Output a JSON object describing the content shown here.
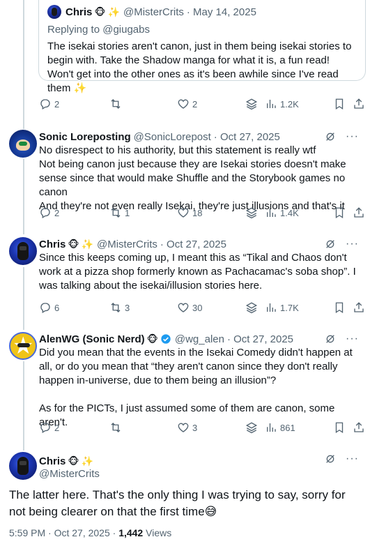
{
  "quoted": {
    "name": "Chris",
    "badges": [
      "🐵",
      "✨"
    ],
    "handle": "@MisterCrits",
    "date": "· May 14, 2025",
    "replying_to": "Replying to @giugabs",
    "text": "The isekai stories aren't canon, just in them being isekai stories to begin with. Take the Shadow manga for what it is, a fun read! Won't get into the other ones as it's been awhile since I've read them ✨"
  },
  "quoted_actions": {
    "replies": "2",
    "reposts": "",
    "likes": "2",
    "views": "1.2K"
  },
  "tweets": [
    {
      "name": "Sonic Loreposting",
      "badges": [],
      "handle": "@SonicLorepost",
      "date": "· Oct 27, 2025",
      "lines": [
        "No disrespect to his authority, but this statement is really wtf",
        "Not being canon just because they are Isekai stories doesn't make sense since that would make Shuffle and the Storybook games no canon",
        "And they're not even really Isekai, they're just illusions and that's it"
      ],
      "replies": "2",
      "reposts": "1",
      "likes": "18",
      "views": "1.4K"
    },
    {
      "name": "Chris",
      "badges": [
        "🐵",
        "✨"
      ],
      "handle": "@MisterCrits",
      "date": "· Oct 27, 2025",
      "lines": [
        "Since this keeps coming up, I meant this as “Tikal and Chaos don't work at a pizza shop formerly known as Pachacamac's soba shop”. I was talking about the isekai/illusion stories here."
      ],
      "replies": "6",
      "reposts": "3",
      "likes": "30",
      "views": "1.7K"
    },
    {
      "name": "AlenWG (Sonic Nerd)",
      "badges": [
        "🐵"
      ],
      "handle": "@wg_alen",
      "date": "· Oct 27, 2025",
      "lines": [
        "Did you mean that the events in the Isekai Comedy didn't happen at all, or do you mean that “they aren't canon since they don't really happen in-universe, due to them being an illusion”?",
        "",
        "As for the PICTs, I just assumed some of them are canon, some aren't."
      ],
      "replies": "2",
      "reposts": "",
      "likes": "3",
      "views": "861"
    }
  ],
  "main": {
    "name": "Chris",
    "badges": [
      "🐵",
      "✨"
    ],
    "handle": "@MisterCrits",
    "text": "The latter here. That's the only thing I was trying to say, sorry for not being clearer on that the first time😅",
    "time": "5:59 PM · Oct 27, 2025 · ",
    "views_count": "1,442",
    "views_label": " Views"
  },
  "colors": {
    "text": "#0f1419",
    "muted": "#536471",
    "line": "#cfd9de",
    "verified": "#1d9bf0"
  }
}
